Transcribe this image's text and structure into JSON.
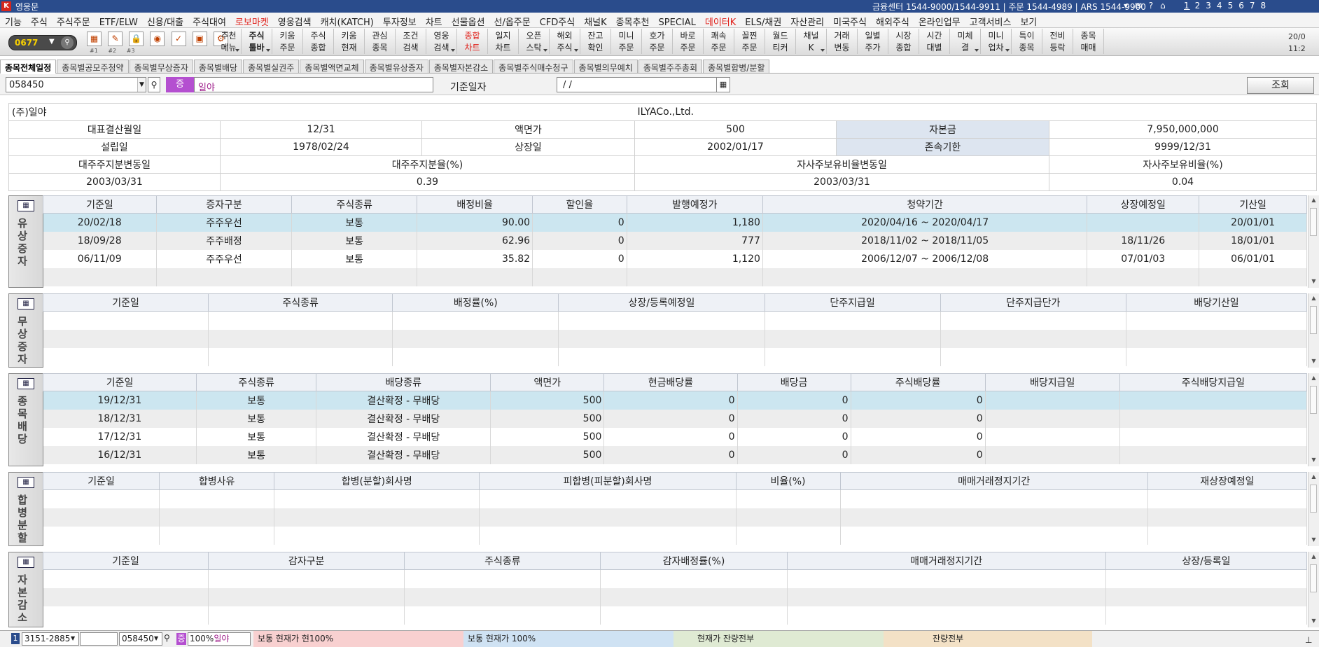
{
  "titlebar": {
    "title": "영웅문",
    "info": "금융센터 1544-9000/1544-9911 | 주문 1544-4989 | ARS 1544-9900",
    "pages": [
      "1",
      "2",
      "3",
      "4",
      "5",
      "6",
      "7",
      "8"
    ]
  },
  "menu": [
    "기능",
    "주식",
    "주식주문",
    "ETF/ELW",
    "신용/대출",
    "주식대여",
    "로보마켓",
    "영웅검색",
    "캐치(KATCH)",
    "투자정보",
    "차트",
    "선물옵션",
    "선/옵주문",
    "CFD주식",
    "채널K",
    "종목추천",
    "SPECIAL",
    "데이터K",
    "ELS/채권",
    "자산관리",
    "미국주식",
    "해외주식",
    "온라인업무",
    "고객서비스",
    "보기"
  ],
  "menu_red": [
    "로보마켓",
    "데이터K"
  ],
  "toolbar": {
    "screen_no": "0677",
    "sub": [
      "#1",
      "#2",
      "#3"
    ],
    "buttons": [
      {
        "l1": "추천",
        "l2": "메뉴",
        "dd": true
      },
      {
        "l1": "주식",
        "l2": "툴바",
        "dd": true,
        "bold": true
      },
      {
        "l1": "키움",
        "l2": "주문"
      },
      {
        "l1": "주식",
        "l2": "종합"
      },
      {
        "l1": "키움",
        "l2": "현재"
      },
      {
        "l1": "관심",
        "l2": "종목"
      },
      {
        "l1": "조건",
        "l2": "검색"
      },
      {
        "l1": "영웅",
        "l2": "검색",
        "dd": true
      },
      {
        "l1": "종합",
        "l2": "차트",
        "red": true
      },
      {
        "l1": "일지",
        "l2": "차트"
      },
      {
        "l1": "오픈",
        "l2": "스탁",
        "dd": true
      },
      {
        "l1": "해외",
        "l2": "주식",
        "dd": true
      },
      {
        "l1": "잔고",
        "l2": "확인"
      },
      {
        "l1": "미니",
        "l2": "주문"
      },
      {
        "l1": "호가",
        "l2": "주문"
      },
      {
        "l1": "바로",
        "l2": "주문"
      },
      {
        "l1": "쾌속",
        "l2": "주문"
      },
      {
        "l1": "꼴찐",
        "l2": "주문"
      },
      {
        "l1": "월드",
        "l2": "티커"
      },
      {
        "l1": "채널",
        "l2": "K",
        "dd": true
      },
      {
        "l1": "거래",
        "l2": "변동"
      },
      {
        "l1": "일별",
        "l2": "주가"
      },
      {
        "l1": "시장",
        "l2": "종합"
      },
      {
        "l1": "시간",
        "l2": "대별"
      },
      {
        "l1": "미체",
        "l2": "결",
        "dd": true
      },
      {
        "l1": "미니",
        "l2": "업차",
        "dd": true
      },
      {
        "l1": "특이",
        "l2": "종목"
      },
      {
        "l1": "전비",
        "l2": "등락"
      },
      {
        "l1": "종목",
        "l2": "매매"
      }
    ],
    "date": "20/0",
    "time": "11:2"
  },
  "tabs": [
    "종목전체일정",
    "종목별공모주청약",
    "종목별무상증자",
    "종목별배당",
    "종목별실권주",
    "종목별액면교체",
    "종목별유상증자",
    "종목별자본감소",
    "종목별주식매수청구",
    "종목별의무예치",
    "종목별주주총회",
    "종목별합병/분할"
  ],
  "search": {
    "code": "058450",
    "market_badge": "증",
    "name": "일야",
    "date_label": "기준일자",
    "date_value": "/   /",
    "query_button": "조회"
  },
  "company": {
    "name_kr": "(주)일야",
    "name_en": "ILYACo.,Ltd.",
    "row1": [
      "대표결산월일",
      "12/31",
      "액면가",
      "500",
      "자본금",
      "7,950,000,000"
    ],
    "row2": [
      "설립일",
      "1978/02/24",
      "상장일",
      "2002/01/17",
      "존속기한",
      "9999/12/31"
    ],
    "row3": [
      "대주주지분변동일",
      "대주주지분율(%)",
      "자사주보유비율변동일",
      "자사주보유비율(%)"
    ],
    "row4": [
      "2003/03/31",
      "0.39",
      "2003/03/31",
      "0.04"
    ]
  },
  "sections": [
    {
      "id": "paid",
      "title": "유상증자",
      "cols": [
        "기준일",
        "증자구분",
        "주식종류",
        "배정비율",
        "할인율",
        "발행예정가",
        "청약기간",
        "상장예정일",
        "기산일"
      ],
      "rows": [
        [
          "20/02/18",
          "주주우선",
          "보통",
          "90.00",
          "0",
          "1,180",
          "2020/04/16 ~ 2020/04/17",
          "",
          "20/01/01"
        ],
        [
          "18/09/28",
          "주주배정",
          "보통",
          "62.96",
          "0",
          "777",
          "2018/11/02 ~ 2018/11/05",
          "18/11/26",
          "18/01/01"
        ],
        [
          "06/11/09",
          "주주우선",
          "보통",
          "35.82",
          "0",
          "1,120",
          "2006/12/07 ~ 2006/12/08",
          "07/01/03",
          "06/01/01"
        ],
        [
          "",
          "",
          "",
          "",
          "",
          "",
          "",
          "",
          ""
        ]
      ]
    },
    {
      "id": "free",
      "title": "무상증자",
      "cols": [
        "기준일",
        "주식종류",
        "배정률(%)",
        "상장/등록예정일",
        "단주지급일",
        "단주지급단가",
        "배당기산일"
      ],
      "rows": [
        [
          "",
          "",
          "",
          "",
          "",
          "",
          ""
        ],
        [
          "",
          "",
          "",
          "",
          "",
          "",
          ""
        ],
        [
          "",
          "",
          "",
          "",
          "",
          "",
          ""
        ]
      ]
    },
    {
      "id": "dividend",
      "title": "종목배당",
      "cols": [
        "기준일",
        "주식종류",
        "배당종류",
        "액면가",
        "현금배당률",
        "배당금",
        "주식배당률",
        "배당지급일",
        "주식배당지급일"
      ],
      "rows": [
        [
          "19/12/31",
          "보통",
          "결산확정 - 무배당",
          "500",
          "0",
          "0",
          "0",
          "",
          ""
        ],
        [
          "18/12/31",
          "보통",
          "결산확정 - 무배당",
          "500",
          "0",
          "0",
          "0",
          "",
          ""
        ],
        [
          "17/12/31",
          "보통",
          "결산확정 - 무배당",
          "500",
          "0",
          "0",
          "0",
          "",
          ""
        ],
        [
          "16/12/31",
          "보통",
          "결산확정 - 무배당",
          "500",
          "0",
          "0",
          "0",
          "",
          ""
        ]
      ]
    },
    {
      "id": "merger",
      "title": "합병분할",
      "cols": [
        "기준일",
        "합병사유",
        "합병(분할)회사명",
        "피합병(피분할)회사명",
        "비율(%)",
        "매매거래정지기간",
        "재상장예정일"
      ],
      "rows": [
        [
          "",
          "",
          "",
          "",
          "",
          "",
          ""
        ],
        [
          "",
          "",
          "",
          "",
          "",
          "",
          ""
        ],
        [
          "",
          "",
          "",
          "",
          "",
          "",
          ""
        ]
      ]
    },
    {
      "id": "capred",
      "title": "자본감소",
      "cols": [
        "기준일",
        "감자구분",
        "주식종류",
        "감자배정률(%)",
        "매매거래정지기간",
        "상장/등록일"
      ],
      "rows": [
        [
          "",
          "",
          "",
          "",
          "",
          ""
        ],
        [
          "",
          "",
          "",
          "",
          "",
          ""
        ],
        [
          "",
          "",
          "",
          "",
          "",
          ""
        ]
      ]
    }
  ],
  "status": {
    "account": "3151-2885",
    "code": "058450",
    "badge": "증",
    "pct": "100%",
    "name": "일야",
    "seg1": "보통   현재가   현100%",
    "seg2": "보통   현재가   100%",
    "seg3": "현재가   잔량전부",
    "seg4": "잔량전부"
  }
}
